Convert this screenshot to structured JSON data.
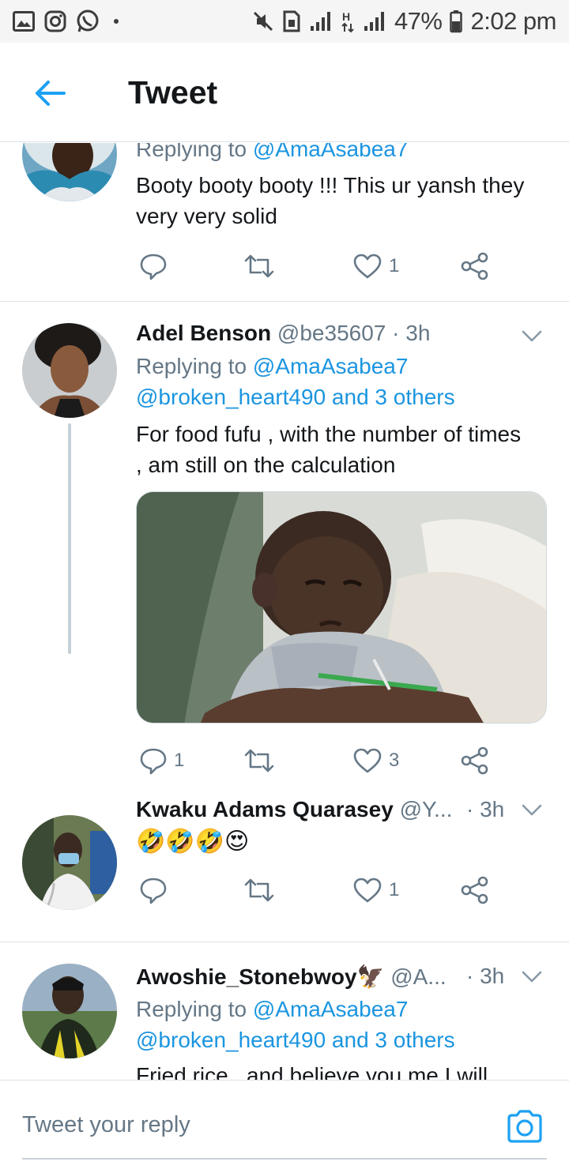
{
  "status_bar": {
    "battery": "47%",
    "time": "2:02 pm",
    "left_icons": [
      "gallery-icon",
      "instagram-icon",
      "whatsapp-icon"
    ],
    "right_icons": [
      "mute-icon",
      "sim-icon",
      "signal-icon",
      "data-h-icon",
      "signal-icon",
      "battery-icon"
    ]
  },
  "header": {
    "title": "Tweet",
    "back_icon": "arrow-left-icon",
    "accent": "#1da1f2"
  },
  "tweets": [
    {
      "reply_to": "Replying to ",
      "reply_to_handle": "@AmaAsabea7",
      "text": "Booty booty booty !!! This ur yansh they very very solid",
      "likes": "1"
    },
    {
      "name": "Adel Benson",
      "handle": "@be35607",
      "time": "· 3h",
      "reply_to": "Replying to ",
      "reply_to_handle": "@AmaAsabea7",
      "reply_to_others": "@broken_heart490 and 3 others",
      "text": "For food fufu , with the number of times , am still on the calculation",
      "replies": "1",
      "likes": "3"
    },
    {
      "name": "Kwaku Adams Quarasey",
      "handle": "@Y...",
      "time": "· 3h",
      "text": "🤣🤣🤣😍",
      "likes": "1"
    },
    {
      "name": "Awoshie_Stonebwoy🦅",
      "handle": "@A...",
      "time": "· 3h",
      "reply_to": "Replying to ",
      "reply_to_handle": "@AmaAsabea7",
      "reply_to_others": "@broken_heart490 and 3 others",
      "text": "Fried rice , and believe you me I will"
    }
  ],
  "reply_bar": {
    "placeholder": "Tweet your reply",
    "camera_icon": "camera-icon"
  },
  "colors": {
    "link": "#1b95e0",
    "muted": "#657786",
    "divider": "#dbe1e6"
  }
}
